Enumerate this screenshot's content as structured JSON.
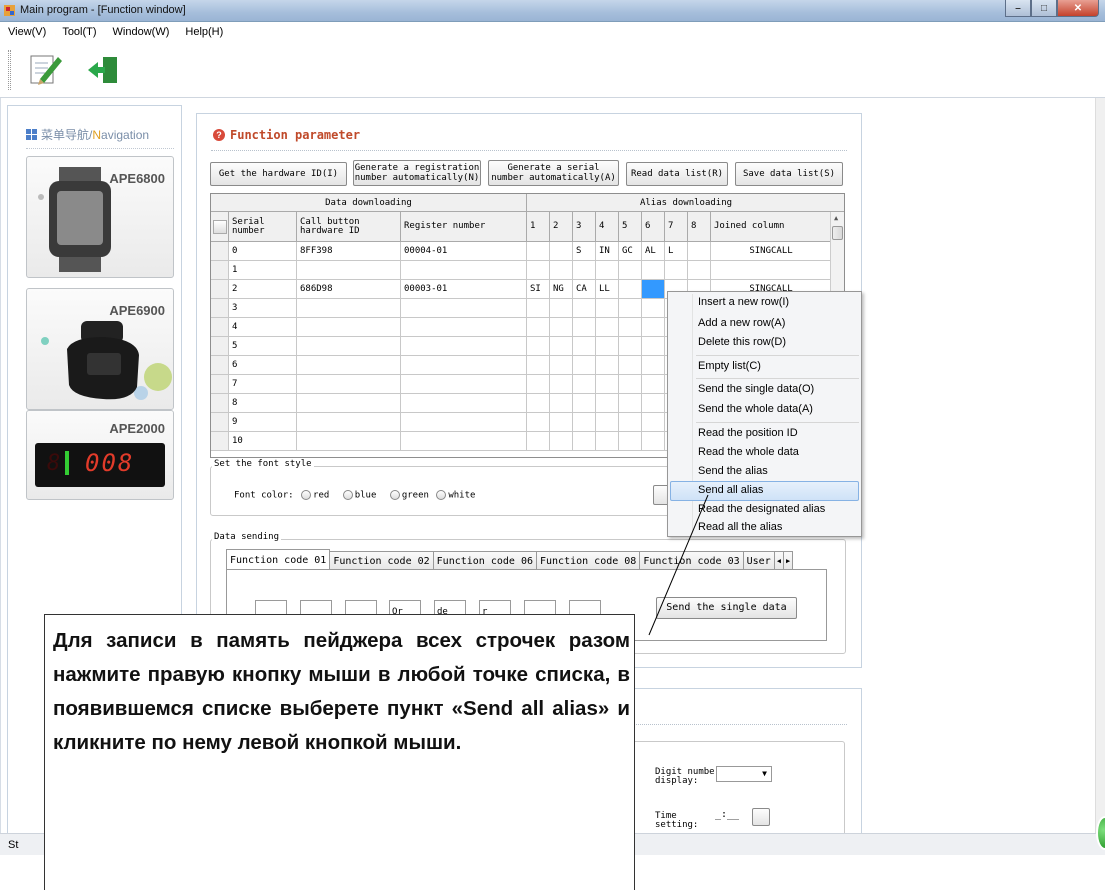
{
  "window": {
    "title": "Main program - [Function window]"
  },
  "menu": [
    "View(V)",
    "Tool(T)",
    "Window(W)",
    "Help(H)"
  ],
  "toolbar": {
    "icons": [
      "edit-icon",
      "exit-icon"
    ]
  },
  "nav": {
    "title_cn": "菜单导航",
    "title_sep": " / ",
    "title_n": "N",
    "title_rest": "avigation",
    "cards": [
      "APE6800",
      "APE6900",
      "APE2000"
    ],
    "ape2000_digits": "008"
  },
  "func": {
    "title": "Function parameter",
    "buttons": {
      "hw_id": "Get the hardware ID(I)",
      "gen_reg_1": "Generate a registration",
      "gen_reg_2": "number automatically(N)",
      "gen_serial_1": "Generate a serial",
      "gen_serial_2": "number automatically(A)",
      "read_list": "Read data list(R)",
      "save_list": "Save data list(S)"
    },
    "group_headers": {
      "download": "Data downloading",
      "alias": "Alias downloading"
    },
    "columns": {
      "serial_1": "Serial",
      "serial_2": "number",
      "hw_1": "Call button",
      "hw_2": "hardware ID",
      "reg": "Register number",
      "n1": "1",
      "n2": "2",
      "n3": "3",
      "n4": "4",
      "n5": "5",
      "n6": "6",
      "n7": "7",
      "n8": "8",
      "joined": "Joined column"
    },
    "rows": [
      {
        "serial": "0",
        "hw": "8FF398",
        "reg": "00004-01",
        "a1": "",
        "a2": "",
        "a3": "S",
        "a4": "IN",
        "a5": "GC",
        "a6": "AL",
        "a7": "L",
        "a8": "",
        "joined": "SINGCALL"
      },
      {
        "serial": "1",
        "hw": "",
        "reg": "",
        "a1": "",
        "a2": "",
        "a3": "",
        "a4": "",
        "a5": "",
        "a6": "",
        "a7": "",
        "a8": "",
        "joined": ""
      },
      {
        "serial": "2",
        "hw": "686D98",
        "reg": "00003-01",
        "a1": "SI",
        "a2": "NG",
        "a3": "CA",
        "a4": "LL",
        "a5": "",
        "a6": "",
        "a7": "",
        "a8": "",
        "joined": "SINGCALL"
      },
      {
        "serial": "3"
      },
      {
        "serial": "4"
      },
      {
        "serial": "5"
      },
      {
        "serial": "6"
      },
      {
        "serial": "7"
      },
      {
        "serial": "8"
      },
      {
        "serial": "9"
      },
      {
        "serial": "10"
      }
    ],
    "font_style": {
      "label": "Set the font style",
      "font_color": "Font color:",
      "options": [
        "red",
        "blue",
        "green",
        "white"
      ]
    },
    "data_sending": {
      "label": "Data sending",
      "tabs": [
        "Function code 01",
        "Function code 02",
        "Function code 06",
        "Function code 08",
        "Function code 03",
        "User"
      ],
      "boxes": [
        "",
        "",
        "",
        "Or",
        "de",
        "r",
        "",
        ""
      ],
      "send_single": "Send the single data"
    }
  },
  "lower": {
    "digit_1": "Digit number",
    "digit_2": "display:",
    "time_1": "Time",
    "time_2": "setting:",
    "time_value": "_:__"
  },
  "context_menu": [
    "Insert a new row(I)",
    "Add a new row(A)",
    "Delete this row(D)",
    "Empty list(C)",
    "Send the single data(O)",
    "Send the whole data(A)",
    "Read the position ID",
    "Read the whole data",
    "Send the alias",
    "Send all alias",
    "Read the designated alias",
    "Read all the alias"
  ],
  "status": "St",
  "callout": "Для записи в память пейджера всех строчек разом нажмите правую кнопку мыши в любой точке списка, в появившемся списке выберете пункт «Send all alias» и кликните по нему левой кнопкой мыши."
}
